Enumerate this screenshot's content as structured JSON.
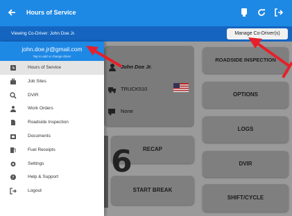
{
  "appbar": {
    "title": "Hours of Service",
    "actions": [
      {
        "icon": "device-icon"
      },
      {
        "icon": "refresh-icon"
      },
      {
        "icon": "logout-icon"
      }
    ]
  },
  "codriver_bar": {
    "viewing_text": "Viewing Co-Driver: John Doe Jr.",
    "manage_button": "Manage Co-Driver(s)"
  },
  "drawer": {
    "email": "john.doe.jr@gmail.com",
    "hint": "Tap to add or change driver",
    "items": [
      {
        "label": "Hours of Service",
        "icon": "clock-icon",
        "active": true
      },
      {
        "label": "Job Sites",
        "icon": "briefcase-icon"
      },
      {
        "label": "DVIR",
        "icon": "search-icon"
      },
      {
        "label": "Work Orders",
        "icon": "person-icon"
      },
      {
        "label": "Roadside Inspection",
        "icon": "document-icon"
      },
      {
        "label": "Documents",
        "icon": "folder-icon"
      },
      {
        "label": "Fuel Receipts",
        "icon": "fuel-icon"
      },
      {
        "label": "Settings",
        "icon": "gear-icon"
      },
      {
        "label": "Help & Support",
        "icon": "help-icon"
      },
      {
        "label": "Logout",
        "icon": "logout-icon"
      }
    ]
  },
  "main": {
    "driver": "John Doe Jr.",
    "truck": "TRUCK510",
    "trailer": "None",
    "buttons": {
      "roadside": "ROADSIDE INSPECTION",
      "options": "OPTIONS",
      "logs": "LOGS",
      "dvir": "DVIR",
      "shift": "SHIFT/CYCLE",
      "recap": "RECAP",
      "start_break": "START BREAK"
    }
  },
  "overlay": {
    "step_number": "6",
    "arrow_color": "#e5202a"
  },
  "colors": {
    "primary": "#1e88e5",
    "primary_dark": "#1565c0",
    "dim_overlay": "#9a9a9a"
  }
}
